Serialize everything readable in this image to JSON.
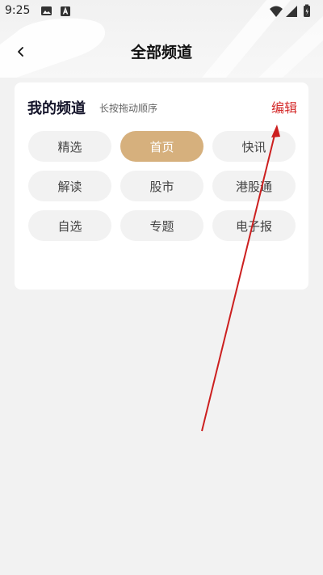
{
  "status_bar": {
    "time": "9:25",
    "left_icons": [
      "image-icon",
      "a-badge-icon"
    ],
    "right_icons": [
      "wifi-icon",
      "signal-icon",
      "battery-icon"
    ]
  },
  "nav": {
    "back_icon": "chevron-left-icon",
    "title": "全部频道"
  },
  "card": {
    "title": "我的频道",
    "hint": "长按拖动顺序",
    "edit_label": "编辑",
    "chips": [
      {
        "label": "精选",
        "active": false
      },
      {
        "label": "首页",
        "active": true
      },
      {
        "label": "快讯",
        "active": false
      },
      {
        "label": "解读",
        "active": false
      },
      {
        "label": "股市",
        "active": false
      },
      {
        "label": "港股通",
        "active": false
      },
      {
        "label": "自选",
        "active": false
      },
      {
        "label": "专题",
        "active": false
      },
      {
        "label": "电子报",
        "active": false
      }
    ]
  },
  "colors": {
    "accent_chip": "#d6b07d",
    "edit_red": "#d42a2a",
    "annotation_arrow": "#cc1f1f",
    "background": "#f2f2f2",
    "card": "#ffffff"
  }
}
